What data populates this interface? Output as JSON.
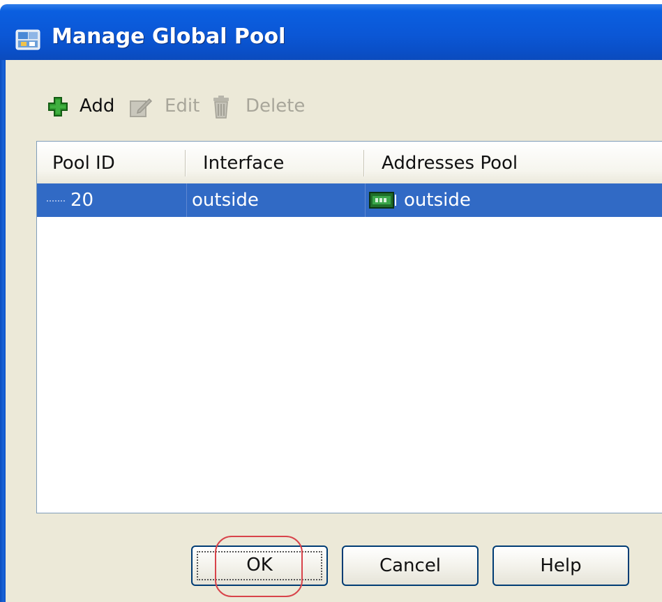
{
  "window": {
    "title": "Manage Global Pool",
    "title_icon": "asdm-app-icon"
  },
  "toolbar": {
    "add_label": "Add",
    "add_icon": "plus-icon",
    "edit_label": "Edit",
    "edit_icon": "edit-icon",
    "delete_label": "Delete",
    "delete_icon": "trash-icon"
  },
  "table": {
    "columns": [
      "Pool ID",
      "Interface",
      "Addresses Pool"
    ],
    "rows": [
      {
        "pool_id": "20",
        "interface": "outside",
        "addresses_pool": "outside",
        "addresses_pool_icon": "network-interface-icon",
        "selected": true
      }
    ]
  },
  "buttons": {
    "ok_label": "OK",
    "cancel_label": "Cancel",
    "help_label": "Help"
  },
  "colors": {
    "titlebar": "#0b57d6",
    "selection": "#316ac5",
    "dialog_bg": "#ece9d8",
    "annotation_circle": "#d8434a"
  }
}
